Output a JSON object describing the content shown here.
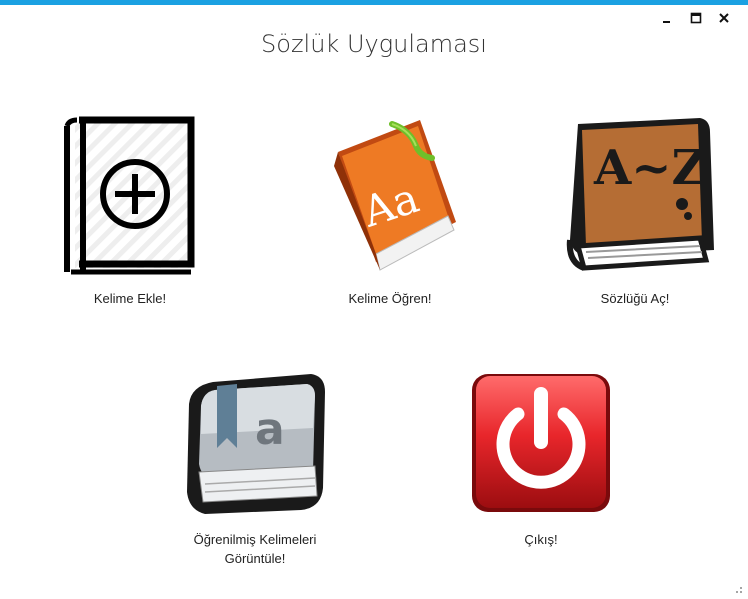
{
  "window": {
    "title": "Sözlük Uygulaması",
    "accent_color": "#1ba1e2",
    "controls": {
      "minimize_icon": "minimize-icon",
      "maximize_icon": "maximize-icon",
      "close_icon": "close-icon"
    }
  },
  "menu": {
    "items": [
      {
        "label": "Kelime Ekle!",
        "icon": "add-word-book-icon"
      },
      {
        "label": "Kelime Öğren!",
        "icon": "learn-word-book-icon"
      },
      {
        "label": "Sözlüğü Aç!",
        "icon": "dictionary-a-z-icon"
      },
      {
        "label_line1": "Öğrenilmiş Kelimeleri",
        "label_line2": "Görüntüle!",
        "icon": "learned-words-book-icon"
      },
      {
        "label": "Çıkış!",
        "icon": "power-icon",
        "color": "#d9252a"
      }
    ]
  }
}
